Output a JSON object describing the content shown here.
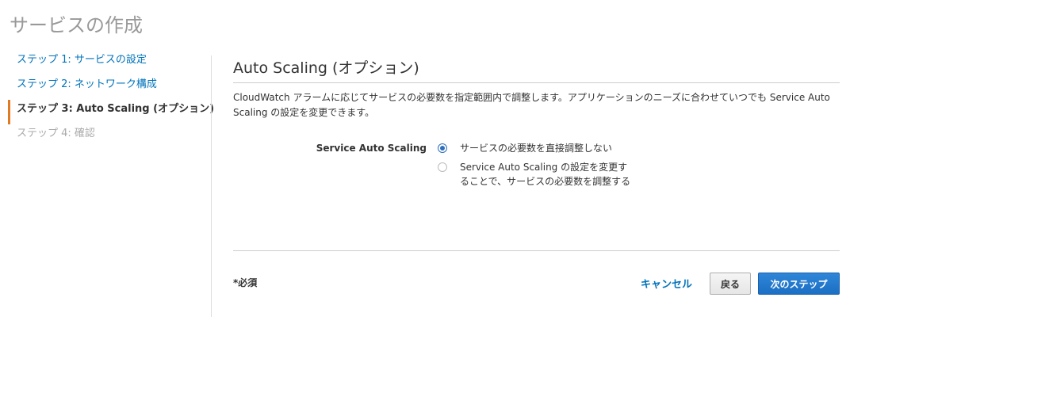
{
  "page": {
    "title": "サービスの作成"
  },
  "wizard": {
    "steps": [
      {
        "label": "ステップ 1: サービスの設定",
        "state": "link"
      },
      {
        "label": "ステップ 2: ネットワーク構成",
        "state": "link"
      },
      {
        "label": "ステップ 3: Auto Scaling (オプション)",
        "state": "active"
      },
      {
        "label": "ステップ 4: 確認",
        "state": "disabled"
      }
    ]
  },
  "section": {
    "title": "Auto Scaling (オプション)",
    "description": "CloudWatch アラームに応じてサービスの必要数を指定範囲内で調整します。アプリケーションのニーズに合わせていつでも Service Auto Scaling の設定を変更できます。"
  },
  "field": {
    "label": "Service Auto Scaling",
    "options": [
      {
        "label": "サービスの必要数を直接調整しない",
        "checked": true
      },
      {
        "label": "Service Auto Scaling の設定を変更することで、サービスの必要数を調整する",
        "checked": false
      }
    ]
  },
  "footer": {
    "required_note": "*必須",
    "cancel_label": "キャンセル",
    "back_label": "戻る",
    "next_label": "次のステップ"
  },
  "colors": {
    "link": "#0073bb",
    "active_step_marker": "#e07b24",
    "primary_button": "#1b6fc4",
    "radio_checked": "#2e6fbd"
  }
}
